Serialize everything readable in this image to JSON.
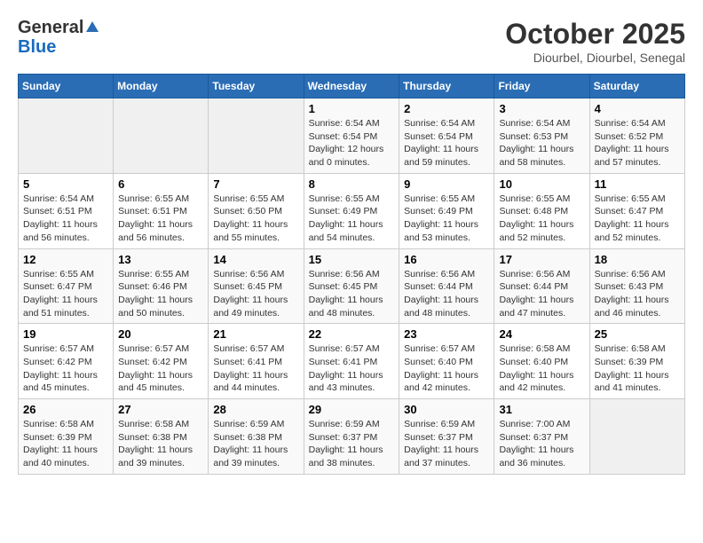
{
  "header": {
    "logo_line1": "General",
    "logo_line2": "Blue",
    "title": "October 2025",
    "subtitle": "Diourbel, Diourbel, Senegal"
  },
  "calendar": {
    "days_of_week": [
      "Sunday",
      "Monday",
      "Tuesday",
      "Wednesday",
      "Thursday",
      "Friday",
      "Saturday"
    ],
    "weeks": [
      [
        {
          "day": "",
          "info": ""
        },
        {
          "day": "",
          "info": ""
        },
        {
          "day": "",
          "info": ""
        },
        {
          "day": "1",
          "info": "Sunrise: 6:54 AM\nSunset: 6:54 PM\nDaylight: 12 hours\nand 0 minutes."
        },
        {
          "day": "2",
          "info": "Sunrise: 6:54 AM\nSunset: 6:54 PM\nDaylight: 11 hours\nand 59 minutes."
        },
        {
          "day": "3",
          "info": "Sunrise: 6:54 AM\nSunset: 6:53 PM\nDaylight: 11 hours\nand 58 minutes."
        },
        {
          "day": "4",
          "info": "Sunrise: 6:54 AM\nSunset: 6:52 PM\nDaylight: 11 hours\nand 57 minutes."
        }
      ],
      [
        {
          "day": "5",
          "info": "Sunrise: 6:54 AM\nSunset: 6:51 PM\nDaylight: 11 hours\nand 56 minutes."
        },
        {
          "day": "6",
          "info": "Sunrise: 6:55 AM\nSunset: 6:51 PM\nDaylight: 11 hours\nand 56 minutes."
        },
        {
          "day": "7",
          "info": "Sunrise: 6:55 AM\nSunset: 6:50 PM\nDaylight: 11 hours\nand 55 minutes."
        },
        {
          "day": "8",
          "info": "Sunrise: 6:55 AM\nSunset: 6:49 PM\nDaylight: 11 hours\nand 54 minutes."
        },
        {
          "day": "9",
          "info": "Sunrise: 6:55 AM\nSunset: 6:49 PM\nDaylight: 11 hours\nand 53 minutes."
        },
        {
          "day": "10",
          "info": "Sunrise: 6:55 AM\nSunset: 6:48 PM\nDaylight: 11 hours\nand 52 minutes."
        },
        {
          "day": "11",
          "info": "Sunrise: 6:55 AM\nSunset: 6:47 PM\nDaylight: 11 hours\nand 52 minutes."
        }
      ],
      [
        {
          "day": "12",
          "info": "Sunrise: 6:55 AM\nSunset: 6:47 PM\nDaylight: 11 hours\nand 51 minutes."
        },
        {
          "day": "13",
          "info": "Sunrise: 6:55 AM\nSunset: 6:46 PM\nDaylight: 11 hours\nand 50 minutes."
        },
        {
          "day": "14",
          "info": "Sunrise: 6:56 AM\nSunset: 6:45 PM\nDaylight: 11 hours\nand 49 minutes."
        },
        {
          "day": "15",
          "info": "Sunrise: 6:56 AM\nSunset: 6:45 PM\nDaylight: 11 hours\nand 48 minutes."
        },
        {
          "day": "16",
          "info": "Sunrise: 6:56 AM\nSunset: 6:44 PM\nDaylight: 11 hours\nand 48 minutes."
        },
        {
          "day": "17",
          "info": "Sunrise: 6:56 AM\nSunset: 6:44 PM\nDaylight: 11 hours\nand 47 minutes."
        },
        {
          "day": "18",
          "info": "Sunrise: 6:56 AM\nSunset: 6:43 PM\nDaylight: 11 hours\nand 46 minutes."
        }
      ],
      [
        {
          "day": "19",
          "info": "Sunrise: 6:57 AM\nSunset: 6:42 PM\nDaylight: 11 hours\nand 45 minutes."
        },
        {
          "day": "20",
          "info": "Sunrise: 6:57 AM\nSunset: 6:42 PM\nDaylight: 11 hours\nand 45 minutes."
        },
        {
          "day": "21",
          "info": "Sunrise: 6:57 AM\nSunset: 6:41 PM\nDaylight: 11 hours\nand 44 minutes."
        },
        {
          "day": "22",
          "info": "Sunrise: 6:57 AM\nSunset: 6:41 PM\nDaylight: 11 hours\nand 43 minutes."
        },
        {
          "day": "23",
          "info": "Sunrise: 6:57 AM\nSunset: 6:40 PM\nDaylight: 11 hours\nand 42 minutes."
        },
        {
          "day": "24",
          "info": "Sunrise: 6:58 AM\nSunset: 6:40 PM\nDaylight: 11 hours\nand 42 minutes."
        },
        {
          "day": "25",
          "info": "Sunrise: 6:58 AM\nSunset: 6:39 PM\nDaylight: 11 hours\nand 41 minutes."
        }
      ],
      [
        {
          "day": "26",
          "info": "Sunrise: 6:58 AM\nSunset: 6:39 PM\nDaylight: 11 hours\nand 40 minutes."
        },
        {
          "day": "27",
          "info": "Sunrise: 6:58 AM\nSunset: 6:38 PM\nDaylight: 11 hours\nand 39 minutes."
        },
        {
          "day": "28",
          "info": "Sunrise: 6:59 AM\nSunset: 6:38 PM\nDaylight: 11 hours\nand 39 minutes."
        },
        {
          "day": "29",
          "info": "Sunrise: 6:59 AM\nSunset: 6:37 PM\nDaylight: 11 hours\nand 38 minutes."
        },
        {
          "day": "30",
          "info": "Sunrise: 6:59 AM\nSunset: 6:37 PM\nDaylight: 11 hours\nand 37 minutes."
        },
        {
          "day": "31",
          "info": "Sunrise: 7:00 AM\nSunset: 6:37 PM\nDaylight: 11 hours\nand 36 minutes."
        },
        {
          "day": "",
          "info": ""
        }
      ]
    ]
  }
}
